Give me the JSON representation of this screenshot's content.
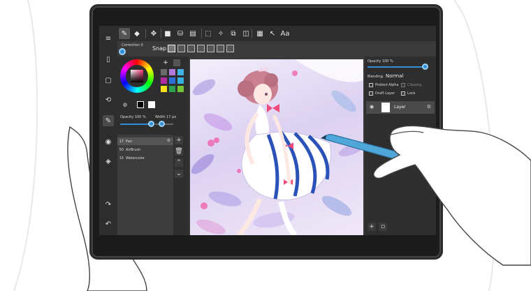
{
  "app": {
    "toolbar_text_tool_label": "Aa"
  },
  "subbar": {
    "correction_label": "Correction 0",
    "snap_label": "Snap"
  },
  "color_panel": {
    "palette_add": "+",
    "opacity_label": "Opacity 100 %",
    "width_label": "Width  17 px",
    "swatches": [
      "#6a6a6a",
      "#b07ad9",
      "#3fb2e6",
      "#b02aa0",
      "#2c6fd6",
      "#35b0e0",
      "#f5e11a",
      "#2fa04d",
      "#73c437"
    ],
    "opacity_value": 1.0,
    "width_value": 0.35
  },
  "brushes": {
    "items": [
      {
        "num": "17",
        "name": "Pen"
      },
      {
        "num": "50",
        "name": "AirBrush"
      },
      {
        "num": "15",
        "name": "Watercolor"
      }
    ],
    "add": "+",
    "more": "⌄"
  },
  "layers": {
    "opacity_label": "Opacity 100 %",
    "opacity_value": 1.0,
    "blending_label": "Blending",
    "blending_value": "Normal",
    "protect_alpha": "Protect Alpha",
    "clipping": "Clipping",
    "draft_layer": "Draft Layer",
    "lock": "Lock",
    "layer_name": "Layer",
    "add": "+"
  },
  "colors": {
    "accent": "#2e8fd6",
    "ui_dark": "#2d2d2d",
    "ui_panel": "#3a3a3a"
  }
}
